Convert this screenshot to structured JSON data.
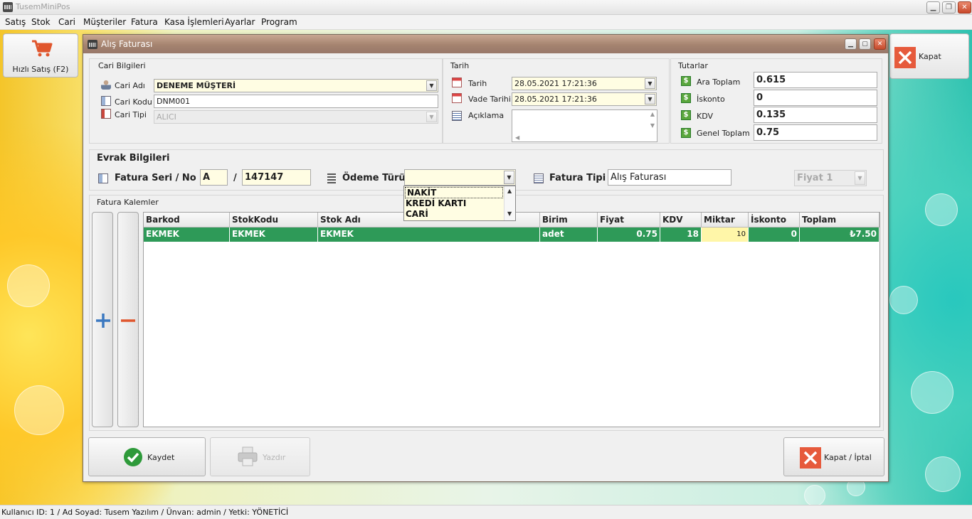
{
  "app": {
    "title": "TusemMiniPos"
  },
  "menu": [
    "Satış",
    "Stok",
    "Cari",
    "Müşteriler",
    "Fatura",
    "Kasa İşlemleri",
    "Ayarlar",
    "Program"
  ],
  "shortcuts": {
    "quick_sale": "Hızlı Satış (F2)",
    "close": "Kapat"
  },
  "dialog": {
    "title": "Alış Faturası",
    "cari": {
      "group_label": "Cari Bilgileri",
      "name_label": "Cari Adı",
      "name_value": "DENEME MÜŞTERİ",
      "code_label": "Cari Kodu",
      "code_value": "DNM001",
      "type_label": "Cari Tipi",
      "type_value": "ALICI"
    },
    "tarih": {
      "group_label": "Tarih",
      "date_label": "Tarih",
      "date_value": "28.05.2021 17:21:36",
      "due_label": "Vade Tarihi",
      "due_value": "28.05.2021 17:21:36",
      "note_label": "Açıklama",
      "note_value": ""
    },
    "tutarlar": {
      "group_label": "Tutarlar",
      "subtotal_label": "Ara Toplam",
      "subtotal_value": "0.615",
      "discount_label": "İskonto",
      "discount_value": "0",
      "kdv_label": "KDV",
      "kdv_value": "0.135",
      "total_label": "Genel Toplam",
      "total_value": "0.75"
    },
    "evrak": {
      "group_label": "Evrak Bilgileri",
      "serial_label": "Fatura Seri / No",
      "serial_value": "A",
      "separator": "/",
      "number_value": "147147",
      "payment_label": "Ödeme Türü",
      "payment_value": "",
      "payment_options": [
        "NAKİT",
        "KREDİ KARTI",
        "CARİ"
      ],
      "invoice_type_label": "Fatura Tipi",
      "invoice_type_value": "Alış Faturası",
      "price_level": "Fiyat 1"
    },
    "items": {
      "group_label": "Fatura Kalemler",
      "columns": [
        "Barkod",
        "StokKodu",
        "Stok Adı",
        "Birim",
        "Fiyat",
        "KDV",
        "Miktar",
        "İskonto",
        "Toplam"
      ],
      "rows": [
        [
          "EKMEK",
          "EKMEK",
          "EKMEK",
          "adet",
          "0.75",
          "18",
          "10",
          "0",
          "₺7.50"
        ]
      ]
    },
    "buttons": {
      "save": "Kaydet",
      "print": "Yazdır",
      "close": "Kapat / İptal"
    }
  },
  "status": "Kullanıcı ID: 1 / Ad Soyad: Tusem Yazılım / Ünvan: admin / Yetki: YÖNETİCİ",
  "colors": {
    "selected_row": "#2e9a58",
    "edit_cell": "#fff6a8",
    "input_yellow": "#fffde3",
    "dialog_title": "#a5836f"
  }
}
